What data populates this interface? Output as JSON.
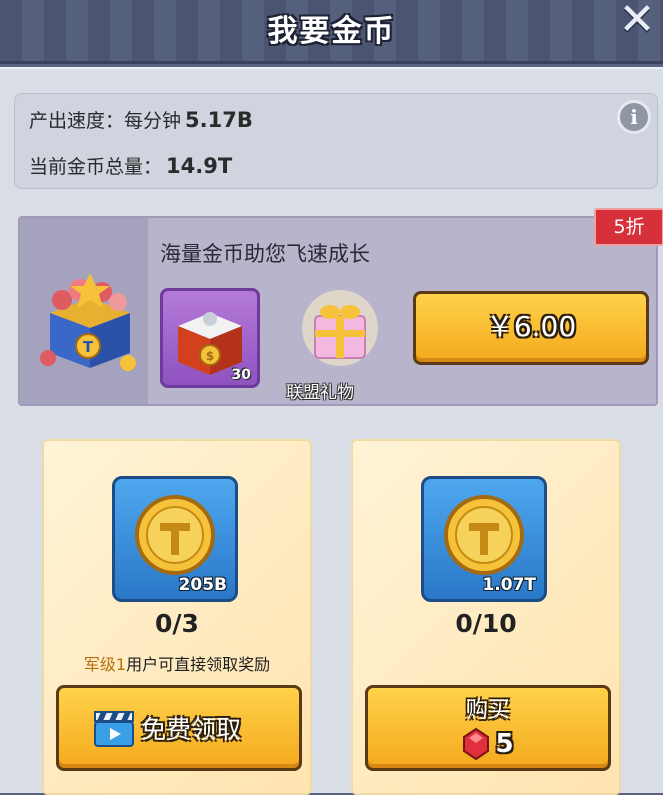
{
  "window": {
    "title": "我要金币",
    "close_symbol": "✕"
  },
  "stats": {
    "rate_label": "产出速度：每分钟",
    "rate_value": "5.17B",
    "total_label": "当前金币总量：",
    "total_value": "14.9T",
    "info_symbol": "i"
  },
  "offer": {
    "title": "海量金币助您飞速成长",
    "discount": "5折",
    "item_count": "30",
    "gift_label": "联盟礼物",
    "price": "￥6.00"
  },
  "cards": [
    {
      "amount": "205B",
      "progress": "0/3",
      "note_highlight": "军级1",
      "note_rest": "用户可直接领取奖励",
      "button_label": "免费领取"
    },
    {
      "amount": "1.07T",
      "progress": "0/10",
      "button_label": "购买",
      "gem_cost": "5"
    }
  ],
  "colors": {
    "accent_gold": "#f4a91d",
    "discount_red": "#d6303a",
    "coin_tile_blue": "#2a78c8"
  },
  "icons": [
    "close-icon",
    "info-icon",
    "treasure-chest-icon",
    "coin-chest-icon",
    "gift-box-icon",
    "gold-coin-icon",
    "film-clapper-icon",
    "red-gem-icon"
  ]
}
